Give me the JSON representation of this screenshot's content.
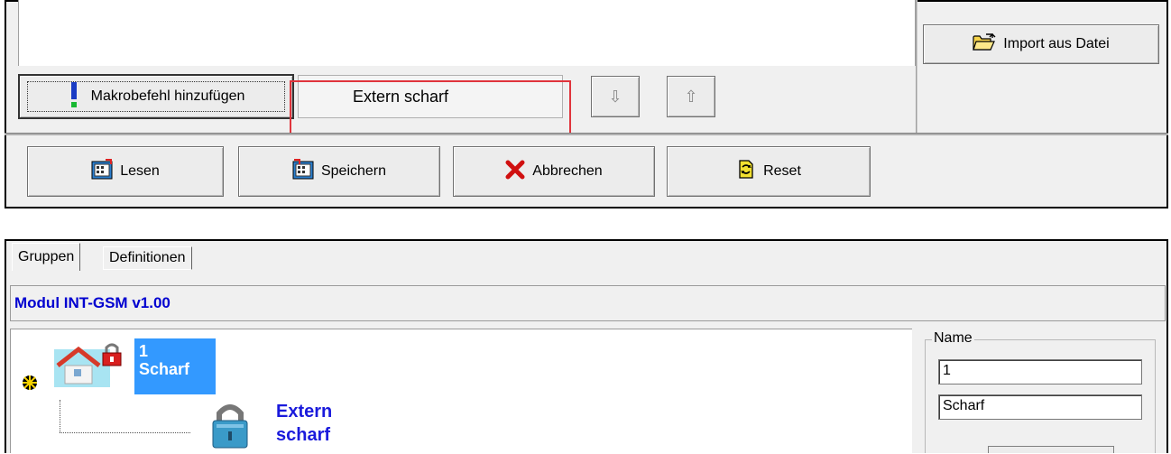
{
  "toolbar_top": {
    "import_label": "Import aus Datei",
    "macro_label": "Makrobefehl hinzufügen",
    "dropdown_value": "Extern scharf",
    "arrow_down": "⇩",
    "arrow_up": "⇧"
  },
  "toolbar_bottom": {
    "read_label": "Lesen",
    "save_label": "Speichern",
    "cancel_label": "Abbrechen",
    "reset_label": "Reset"
  },
  "tabs": [
    {
      "label": "Gruppen"
    },
    {
      "label": "Definitionen"
    }
  ],
  "module_title": "Modul INT-GSM v1.00",
  "tree": {
    "group_number": "1",
    "group_name": "Scharf",
    "child_line1": "Extern",
    "child_line2": "scharf"
  },
  "name_panel": {
    "legend": "Name",
    "field1": "1",
    "field2": "Scharf"
  },
  "colors": {
    "highlight_border": "#e0343c",
    "selection": "#3399ff",
    "module_text": "#0000d0"
  },
  "icons": [
    "folder-open-icon",
    "exclamation-icon",
    "arrow-down-icon",
    "arrow-up-icon",
    "read-icon",
    "save-icon",
    "cancel-x-icon",
    "reset-icon",
    "gear-icon",
    "house-lock-icon",
    "padlock-icon"
  ]
}
